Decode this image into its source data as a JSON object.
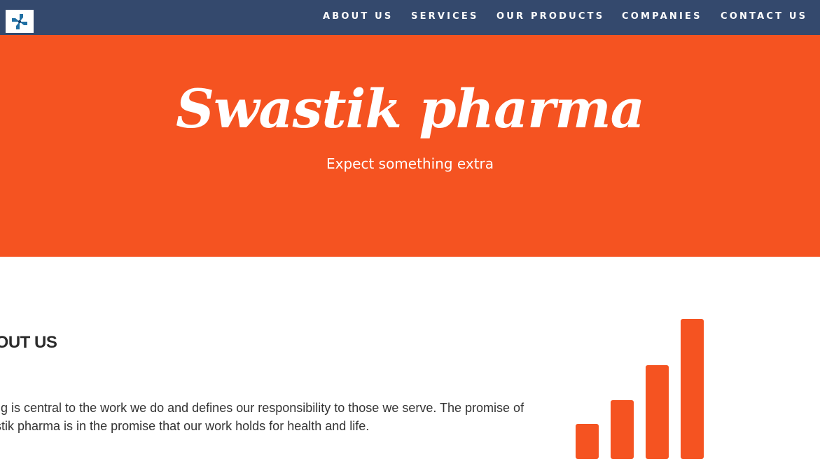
{
  "navbar": {
    "logo_icon": "pinwheel-logo-icon",
    "links": [
      "ABOUT US",
      "SERVICES",
      "OUR PRODUCTS",
      "COMPANIES",
      "CONTACT US"
    ]
  },
  "hero": {
    "title": "Swastik pharma",
    "tagline": "Expect something extra"
  },
  "about": {
    "heading": "ABOUT US",
    "lines": [
      "Caring is central to the work we do and defines our responsibility to those we serve. The promise of",
      "Swastik pharma is in the promise that our work holds for health and life."
    ]
  },
  "graphic": {
    "icon": "bar-chart-icon",
    "levels": [
      0.25,
      0.42,
      0.67,
      1.0
    ]
  },
  "colors": {
    "navbar": "#34496d",
    "accent": "#f55321",
    "logo_blue": "#1f6fa3"
  }
}
